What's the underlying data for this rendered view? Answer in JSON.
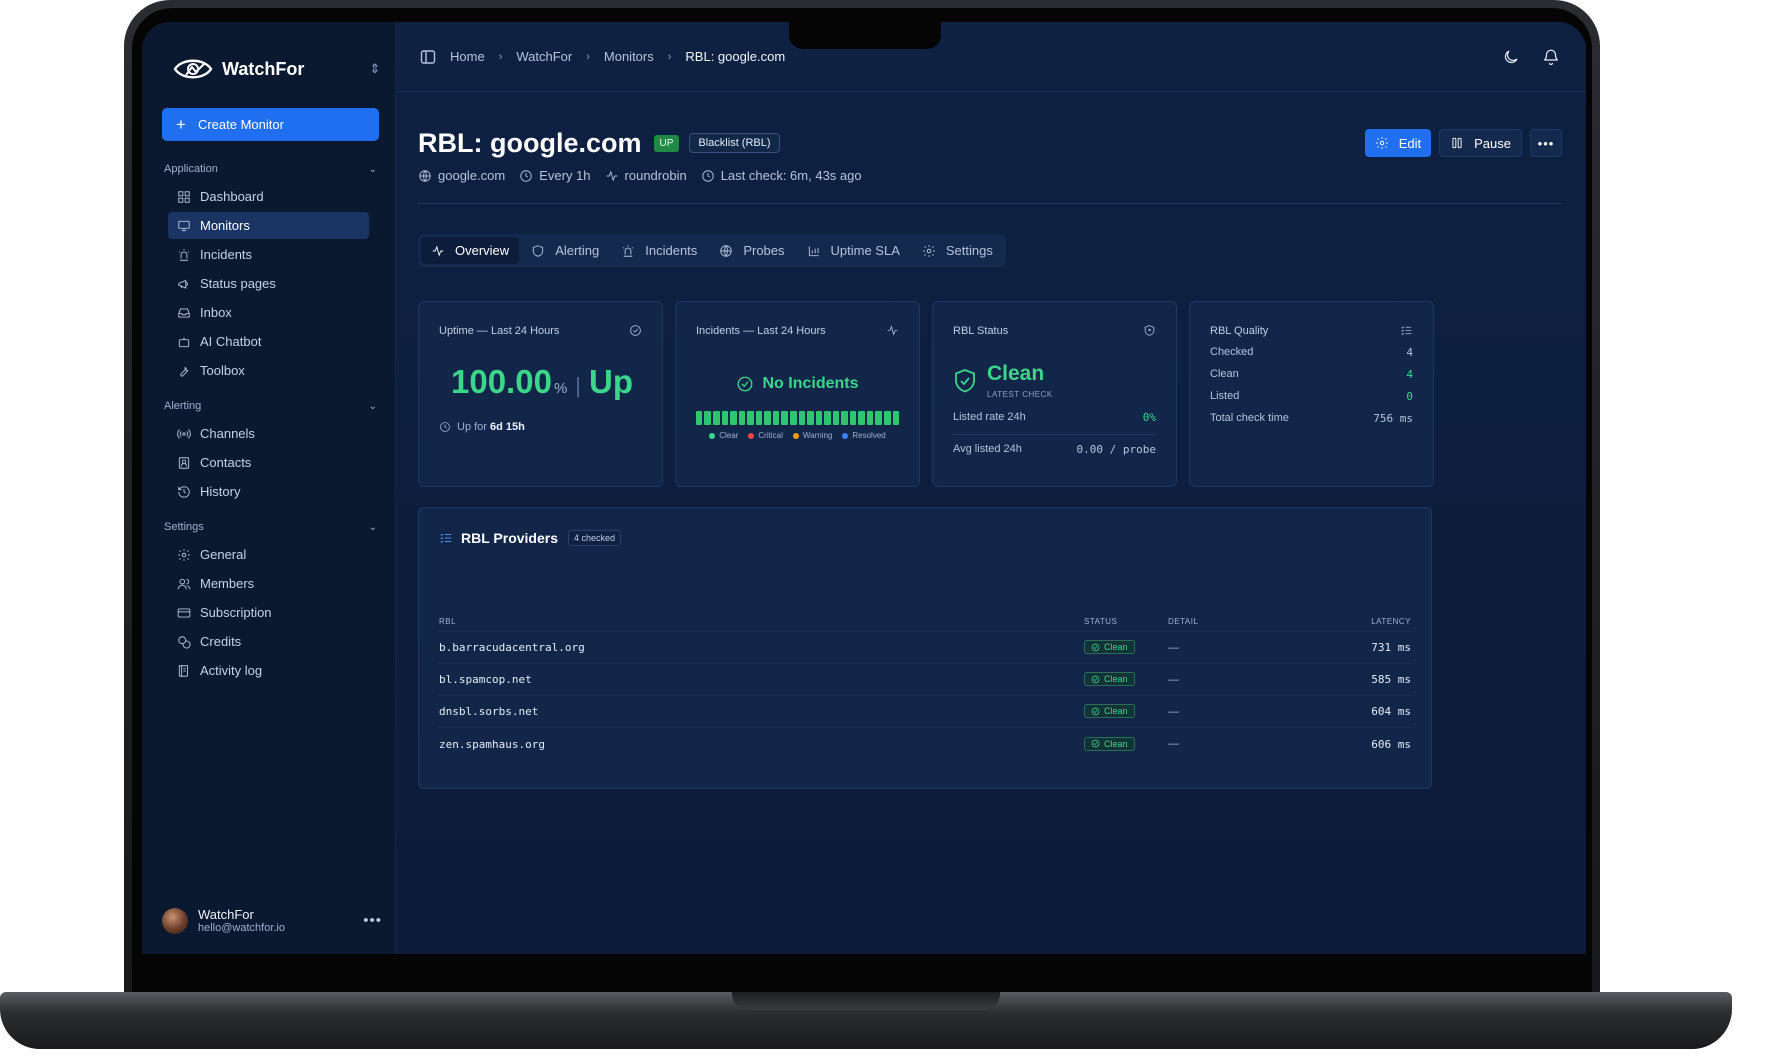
{
  "brand": {
    "name": "WatchFor"
  },
  "sidebar": {
    "create_label": "Create Monitor",
    "sections": [
      {
        "title": "Application",
        "items": [
          {
            "label": "Dashboard",
            "icon": "dashboard-icon"
          },
          {
            "label": "Monitors",
            "icon": "monitor-icon",
            "active": true
          },
          {
            "label": "Incidents",
            "icon": "siren-icon"
          },
          {
            "label": "Status pages",
            "icon": "megaphone-icon"
          },
          {
            "label": "Inbox",
            "icon": "inbox-icon"
          },
          {
            "label": "AI Chatbot",
            "icon": "bot-icon"
          },
          {
            "label": "Toolbox",
            "icon": "wrench-icon"
          }
        ]
      },
      {
        "title": "Alerting",
        "items": [
          {
            "label": "Channels",
            "icon": "radio-icon"
          },
          {
            "label": "Contacts",
            "icon": "contact-icon"
          },
          {
            "label": "History",
            "icon": "history-icon"
          }
        ]
      },
      {
        "title": "Settings",
        "items": [
          {
            "label": "General",
            "icon": "gear-icon"
          },
          {
            "label": "Members",
            "icon": "users-icon"
          },
          {
            "label": "Subscription",
            "icon": "card-icon"
          },
          {
            "label": "Credits",
            "icon": "coins-icon"
          },
          {
            "label": "Activity log",
            "icon": "log-icon"
          }
        ]
      }
    ],
    "user": {
      "name": "WatchFor",
      "email": "hello@watchfor.io"
    }
  },
  "breadcrumb": [
    "Home",
    "WatchFor",
    "Monitors",
    "RBL: google.com"
  ],
  "header": {
    "title": "RBL: google.com",
    "status_badge": "UP",
    "type_badge": "Blacklist (RBL)",
    "edit_label": "Edit",
    "pause_label": "Pause",
    "meta": {
      "host": "google.com",
      "interval": "Every 1h",
      "strategy": "roundrobin",
      "last_check": "Last check: 6m, 43s ago"
    }
  },
  "tabs": [
    "Overview",
    "Alerting",
    "Incidents",
    "Probes",
    "Uptime SLA",
    "Settings"
  ],
  "cards": {
    "uptime": {
      "title": "Uptime — Last 24 Hours",
      "value": "100.00",
      "unit": "%",
      "state": "Up",
      "up_for_label": "Up for",
      "up_for_value": "6d 15h"
    },
    "incidents": {
      "title": "Incidents — Last 24 Hours",
      "message": "No Incidents",
      "bar_count": 24,
      "legend": [
        {
          "label": "Clear",
          "color": "#3cd68a"
        },
        {
          "label": "Critical",
          "color": "#ef4444"
        },
        {
          "label": "Warning",
          "color": "#f59e0b"
        },
        {
          "label": "Resolved",
          "color": "#3b82f6"
        }
      ]
    },
    "rbl_status": {
      "title": "RBL Status",
      "state": "Clean",
      "sub": "LATEST CHECK",
      "listed_rate_label": "Listed rate 24h",
      "listed_rate_value": "0%",
      "avg_listed_label": "Avg listed 24h",
      "avg_listed_value": "0.00 / probe"
    },
    "rbl_quality": {
      "title": "RBL Quality",
      "checked_label": "Checked",
      "checked_value": "4",
      "clean_label": "Clean",
      "clean_value": "4",
      "listed_label": "Listed",
      "listed_value": "0",
      "total_label": "Total check time",
      "total_value": "756 ms"
    }
  },
  "providers": {
    "title": "RBL Providers",
    "count": "4 checked",
    "columns": [
      "RBL",
      "STATUS",
      "DETAIL",
      "LATENCY"
    ],
    "rows": [
      {
        "rbl": "b.barracudacentral.org",
        "status": "Clean",
        "detail": "—",
        "latency": "731 ms"
      },
      {
        "rbl": "bl.spamcop.net",
        "status": "Clean",
        "detail": "—",
        "latency": "585 ms"
      },
      {
        "rbl": "dnsbl.sorbs.net",
        "status": "Clean",
        "detail": "—",
        "latency": "604 ms"
      },
      {
        "rbl": "zen.spamhaus.org",
        "status": "Clean",
        "detail": "—",
        "latency": "606 ms"
      }
    ]
  }
}
